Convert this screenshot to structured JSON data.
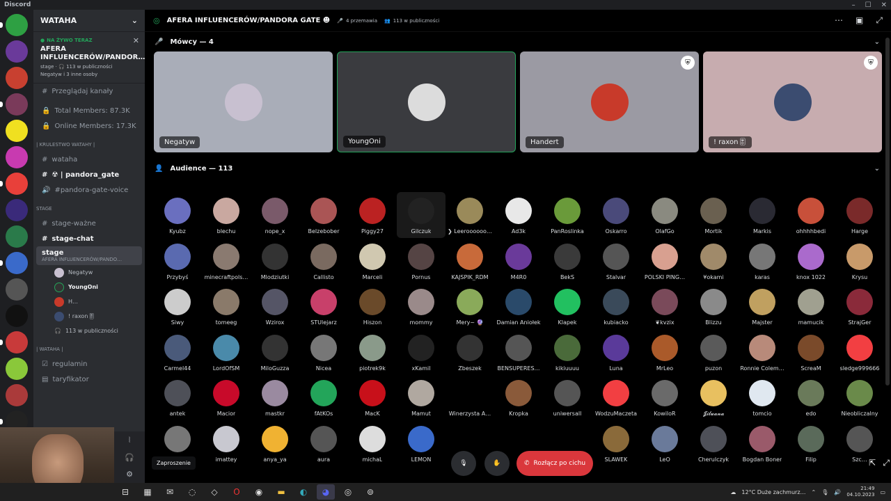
{
  "app": {
    "title": "Discord"
  },
  "guild": {
    "name": "WATAHA"
  },
  "live": {
    "tag": "NA ŻYWO TERAZ",
    "title": "AFERA INFLUENCERÓW/PANDOR…",
    "type": "stage",
    "listeners": "113 w publiczności",
    "people": "Negatyw i 3 inne osoby"
  },
  "channels": {
    "przeglad": "Przeglądaj kanały",
    "total": "Total Members: 87.3K",
    "online": "Online Members: 17.3K",
    "cat1": "| KRULESTWO WATAHY |",
    "wataha": "wataha",
    "pandora": "☢ | pandora_gate",
    "pvoice": "#pandora-gate-voice",
    "cat2": "STAGE",
    "wazne": "stage-ważne",
    "chat": "stage-chat",
    "stage": "stage",
    "stage_sub": "AFERA INFLUENCERÓW/PANDO…",
    "v1": "Negatyw",
    "v2": "YoungOni",
    "v3": "H…",
    "v4": "! raxon🎚",
    "v5": "113 w publiczności",
    "cat3": "| WATAHA |",
    "regulamin": "regulamin",
    "taryfikator": "taryfikator"
  },
  "header": {
    "title": "AFERA INFLUENCERÓW/PANDORA GATE ☻",
    "speaking": "4 przemawia",
    "audience": "113 w publiczności"
  },
  "speakers_label": "Mówcy — 4",
  "audience_label": "Audience — 113",
  "speakers": [
    {
      "name": "Negatyw",
      "bg": "#a9adb8",
      "av": "#c8c0d0"
    },
    {
      "name": "YoungOni",
      "bg": "#3a3b3f",
      "av": "#dcdcdc"
    },
    {
      "name": "Handert",
      "bg": "#9b9aa3",
      "av": "#c83a2a"
    },
    {
      "name": "! raxon🎚",
      "bg": "#c7acaf",
      "av": "#3b4c70"
    }
  ],
  "audience": [
    "Kyubz",
    "blechu",
    "nope_x",
    "Belzebober",
    "Piggy27",
    "Gilczuk",
    "❯ Leeroooooo…",
    "Ad3k",
    "PanRoslinka",
    "Oskarro",
    "OlafGo",
    "Mortik",
    "Markis",
    "ohhhhbedi",
    "Harge",
    "Przybyś",
    "minecraftpols…",
    "Mlodziutki",
    "Callisto",
    "Marceli",
    "Pornus",
    "KAJSPIK_RDM",
    "M4R0",
    "BekS",
    "Stalvar",
    "POLSKI PING…",
    "¥okami",
    "karas",
    "knox 1022",
    "Krysu",
    "Siwy",
    "tomeeg",
    "Wzirox",
    "STUlejarz",
    "Hiszon",
    "mommy",
    "Mery~ 🔮",
    "Damian Aniołek",
    "Klapek",
    "kubiacko",
    "❦kvzix",
    "Blizzu",
    "Majster",
    "mamucik",
    "StrajGer",
    "Carmel44",
    "LordOfSM",
    "MiloGuzza",
    "Nicea",
    "piotrek9k",
    "xKamil",
    "Zbeszek",
    "BENSUPERES…",
    "kikiuuuu",
    "Luna",
    "MrLeo",
    "puzon",
    "Ronnie Colem…",
    "ScreaM",
    "sledge999666",
    "antek",
    "Macior",
    "mastkr",
    "fAtKOs",
    "MacK",
    "Mamut",
    "Winerzysta A…",
    "Kropka",
    "uniwersall",
    "WodzuMaczeta",
    "KowiloR",
    "𝓙𝓲𝓵𝓾𝓪𝓷𝓪",
    "tomcio",
    "edo",
    "Nieobliczalny",
    "",
    "imattey",
    "anya_ya",
    "aura",
    "michaL",
    "LEMON",
    "",
    "",
    "",
    "SLAWEK",
    "LeO",
    "Cherulczyk",
    "Bogdan Boner",
    "Filip",
    "Szc…"
  ],
  "audience_colors": [
    "#6a6fbf",
    "#c9a8a0",
    "#7a5a6a",
    "#a55",
    "#b22",
    "#222",
    "#9a8a5a",
    "#e8e8e8",
    "#6a9a3a",
    "#4a4a7a",
    "#8a8a80",
    "#6a6050",
    "#2a2a33",
    "#c8503a",
    "#7a2a2a",
    "#5a6ab0",
    "#8a7a70",
    "#333",
    "#7a6a60",
    "#d0c8b0",
    "#554444",
    "#c86a3a",
    "#6a3a9a",
    "#3a3a3a",
    "#555",
    "#d8a090",
    "#a08a6a",
    "#777",
    "#aa6acc",
    "#c89a6a",
    "#cccccc",
    "#8a7a6a",
    "#555566",
    "#c8406a",
    "#6a4a2a",
    "#9a8a8a",
    "#8aaa5a",
    "#2a4a6a",
    "#22c060",
    "#3a4a5a",
    "#7a4a5a",
    "#8a8a8a",
    "#c0a060",
    "#a0a090",
    "#8a2a3a",
    "#4a5a7a",
    "#4a8aaa",
    "#333",
    "#777",
    "#8a9a8a",
    "#222",
    "#333",
    "#555",
    "#4a6a3a",
    "#5a3a9a",
    "#aa5a2a",
    "#5a5a5a",
    "#b88a7a",
    "#7a4a2a",
    "#f23f42",
    "#4e5058",
    "#c80a2a",
    "#9a8aa0",
    "#23a55a",
    "#c8101a",
    "#b0a8a0",
    "#000",
    "#8a5a3a",
    "#555",
    "#f23f42",
    "#6a6a6a",
    "#e8c060",
    "#e0e8f0",
    "#6a7a5a",
    "#6a8a4a",
    "#777",
    "#c8c8d0",
    "#f0b232",
    "#555",
    "#ddd",
    "#3a6aca",
    "#000",
    "#000",
    "#000",
    "#8a6a3a",
    "#6a7a9a",
    "#4e5058",
    "#9a5a6a",
    "#5a6a5a",
    "#555"
  ],
  "bottom": {
    "tooltip": "Zaproszenie",
    "leave": "Rozłącz po cichu"
  },
  "taskbar": {
    "weather": "12°C  Duże zachmurz…",
    "time": "21:49",
    "date": "04.10.2023"
  },
  "colors": {
    "accent": "#23a55a",
    "danger": "#da373c"
  }
}
